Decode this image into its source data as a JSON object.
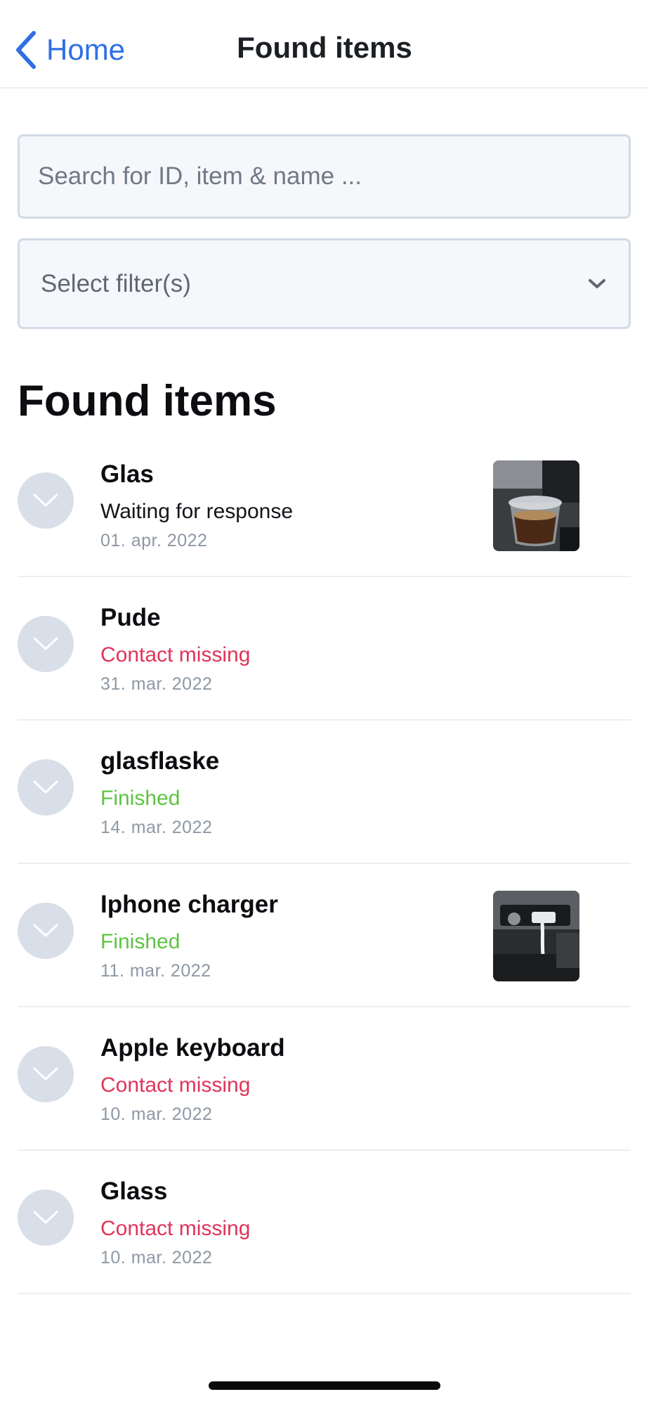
{
  "nav": {
    "back_label": "Home",
    "title": "Found items"
  },
  "search": {
    "placeholder": "Search for ID, item & name ...",
    "value": ""
  },
  "filter": {
    "label": "Select filter(s)"
  },
  "section_title": "Found items",
  "colors": {
    "accent": "#2f6fe4",
    "status_waiting": "#111418",
    "status_missing": "#e0345a",
    "status_finished": "#5ec443"
  },
  "items": [
    {
      "title": "Glas",
      "status": "Waiting for response",
      "status_kind": "waiting",
      "date": "01. apr. 2022",
      "has_image": true,
      "image_icon": "glass-photo"
    },
    {
      "title": "Pude",
      "status": "Contact missing",
      "status_kind": "missing",
      "date": "31. mar. 2022",
      "has_image": false
    },
    {
      "title": "glasflaske",
      "status": "Finished",
      "status_kind": "finished",
      "date": "14. mar. 2022",
      "has_image": false
    },
    {
      "title": "Iphone charger",
      "status": "Finished",
      "status_kind": "finished",
      "date": "11. mar. 2022",
      "has_image": true,
      "image_icon": "charger-photo"
    },
    {
      "title": "Apple keyboard",
      "status": "Contact missing",
      "status_kind": "missing",
      "date": "10. mar. 2022",
      "has_image": false
    },
    {
      "title": "Glass",
      "status": "Contact missing",
      "status_kind": "missing",
      "date": "10. mar. 2022",
      "has_image": false
    }
  ]
}
